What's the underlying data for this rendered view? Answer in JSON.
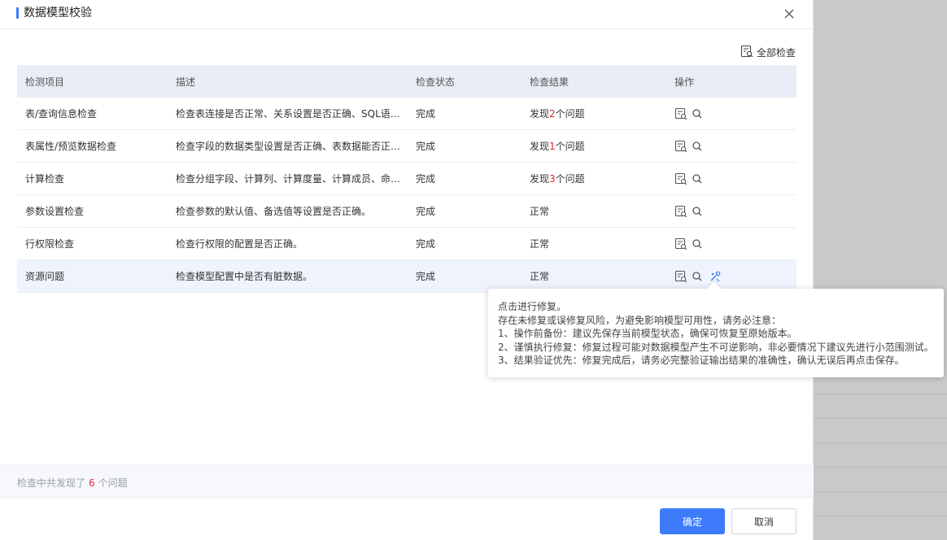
{
  "dialog": {
    "title": "数据模型校验"
  },
  "toolbar": {
    "check_all_label": "全部检查"
  },
  "table": {
    "headers": [
      "检测项目",
      "描述",
      "检查状态",
      "检查结果",
      "操作"
    ],
    "rows": [
      {
        "item": "表/查询信息检查",
        "desc": "检查表连接是否正常、关系设置是否正确、SQL语…",
        "status": "完成",
        "result_prefix": "发现",
        "result_count": "2",
        "result_suffix": "个问题"
      },
      {
        "item": "表属性/预览数据检查",
        "desc": "检查字段的数据类型设置是否正确、表数据能否正…",
        "status": "完成",
        "result_prefix": "发现",
        "result_count": "1",
        "result_suffix": "个问题"
      },
      {
        "item": "计算检查",
        "desc": "检查分组字段、计算列、计算度量、计算成员、命…",
        "status": "完成",
        "result_prefix": "发现",
        "result_count": "3",
        "result_suffix": "个问题"
      },
      {
        "item": "参数设置检查",
        "desc": "检查参数的默认值、备选值等设置是否正确。",
        "status": "完成",
        "result_prefix": "正常",
        "result_count": "",
        "result_suffix": ""
      },
      {
        "item": "行权限检查",
        "desc": "检查行权限的配置是否正确。",
        "status": "完成",
        "result_prefix": "正常",
        "result_count": "",
        "result_suffix": ""
      },
      {
        "item": "资源问题",
        "desc": "检查模型配置中是否有脏数据。",
        "status": "完成",
        "result_prefix": "正常",
        "result_count": "",
        "result_suffix": ""
      }
    ]
  },
  "tooltip": {
    "lines": [
      "点击进行修复。",
      "存在未修复或误修复风险，为避免影响模型可用性，请务必注意：",
      "1、操作前备份：建议先保存当前模型状态，确保可恢复至原始版本。",
      "2、谨慎执行修复：修复过程可能对数据模型产生不可逆影响，非必要情况下建议先进行小范围测试。",
      "3、结果验证优先：修复完成后，请务必完整验证输出结果的准确性，确认无误后再点击保存。"
    ]
  },
  "summary": {
    "prefix": "检查中共发现了",
    "count": "6",
    "suffix": "个问题"
  },
  "footer": {
    "ok_label": "确定",
    "cancel_label": "取消"
  },
  "colors": {
    "accent": "#3e7bfa",
    "danger": "#e0282e",
    "header_bg": "#e9edf5"
  }
}
